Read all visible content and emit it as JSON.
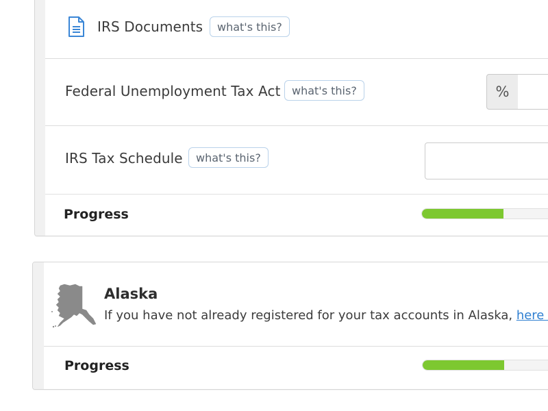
{
  "irs_card": {
    "documents": {
      "label": "IRS Documents",
      "help": "what's this?",
      "icon": "document-icon"
    },
    "futa": {
      "label": "Federal Unemployment Tax Act",
      "help": "what's this?",
      "addon": "%",
      "value": ""
    },
    "schedule": {
      "label": "IRS Tax Schedule",
      "help": "what's this?",
      "value": ""
    },
    "progress": {
      "label": "Progress",
      "fraction_visible": 0.6
    }
  },
  "alaska_card": {
    "title": "Alaska",
    "text": "If you have not already registered for your tax accounts in Alaska, ",
    "link_text": "here is how",
    "icon": "alaska-map-icon",
    "progress": {
      "label": "Progress",
      "fraction_visible": 0.6
    }
  },
  "colors": {
    "progress_fill": "#7dc830",
    "link": "#2f7fd1",
    "help_border": "#b9d2ea",
    "icon_blue": "#3a86d6",
    "map_gray": "#8a8a8a"
  }
}
